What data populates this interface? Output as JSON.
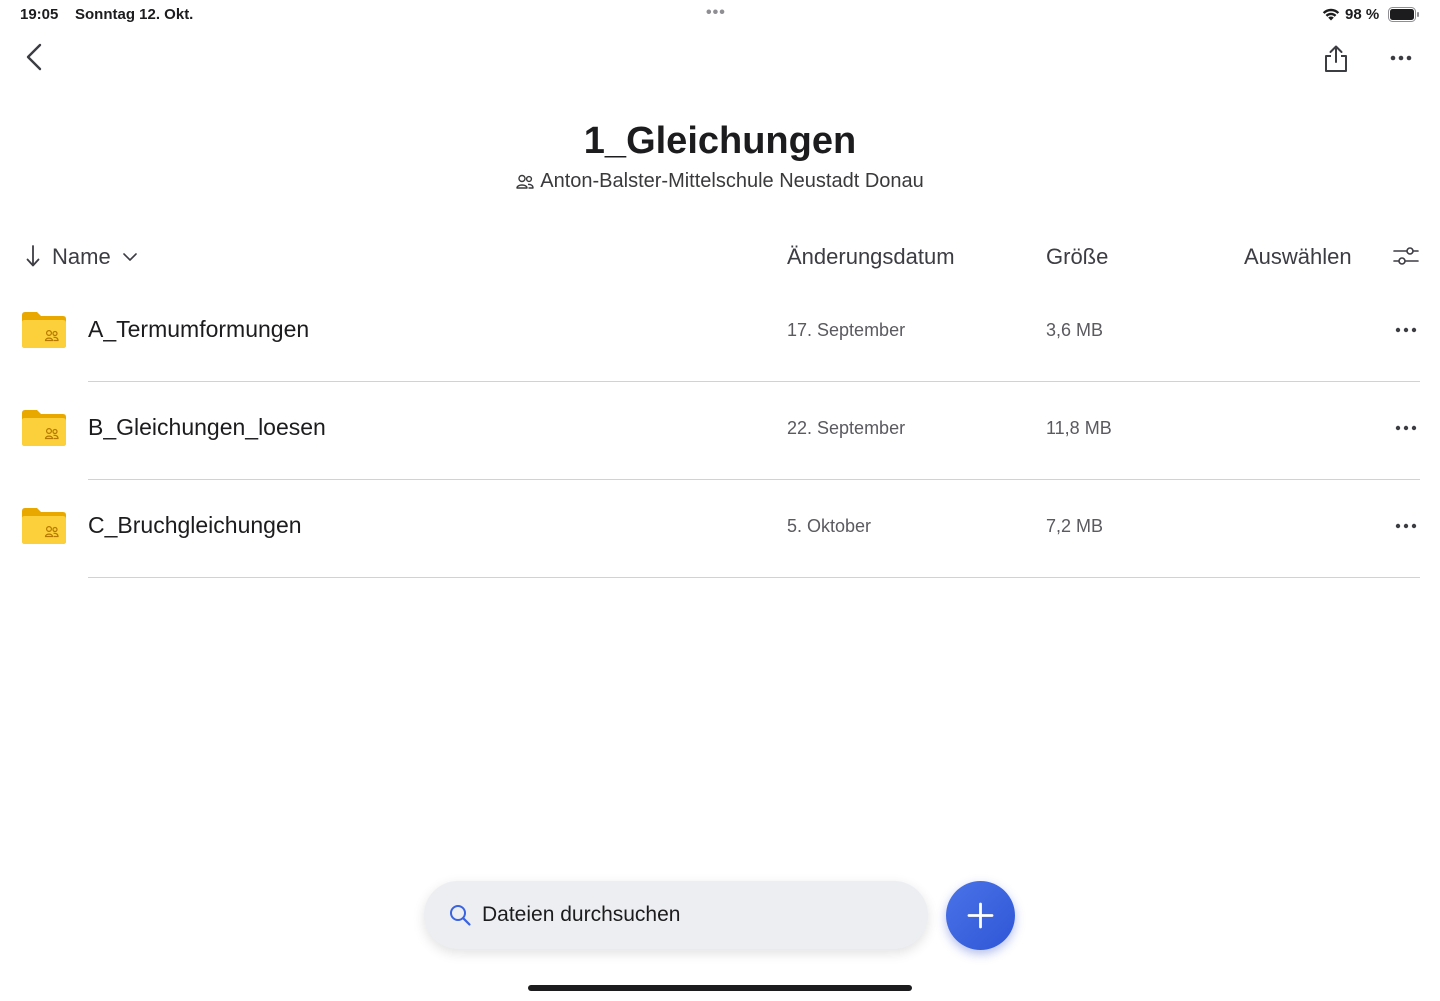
{
  "status_bar": {
    "time": "19:05",
    "date": "Sonntag 12. Okt.",
    "battery": "98 %"
  },
  "folder": {
    "title": "1_Gleichungen",
    "owner": "Anton-Balster-Mittelschule Neustadt Donau"
  },
  "columns": {
    "name": "Name",
    "modified": "Änderungsdatum",
    "size": "Größe",
    "select": "Auswählen"
  },
  "files": [
    {
      "name": "A_Termumformungen",
      "modified": "17. September",
      "size": "3,6 MB"
    },
    {
      "name": "B_Gleichungen_loesen",
      "modified": "22. September",
      "size": "11,8 MB"
    },
    {
      "name": "C_Bruchgleichungen",
      "modified": "5. Oktober",
      "size": "7,2 MB"
    }
  ],
  "search": {
    "placeholder": "Dateien durchsuchen"
  },
  "icons": {
    "back": "chevron-left-icon",
    "share": "share-icon",
    "more": "ellipsis-icon",
    "filter": "sliders-icon",
    "folder": "shared-folder-icon",
    "add": "plus-icon"
  },
  "colors": {
    "accent": "#3a63e0",
    "folder": "#f5c518"
  }
}
